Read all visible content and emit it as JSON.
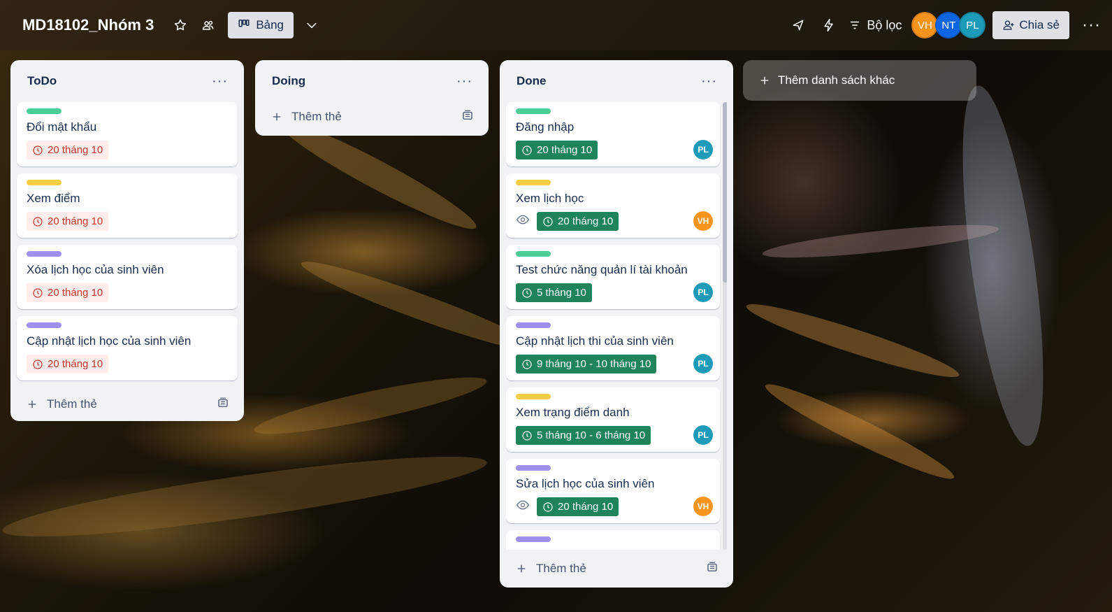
{
  "header": {
    "board_title": "MD18102_Nhóm 3",
    "view_label": "Bảng",
    "filter_label": "Bộ lọc",
    "share_label": "Chia sẻ",
    "members": [
      {
        "initials": "VH",
        "color": "#f7941d"
      },
      {
        "initials": "NT",
        "color": "#0c66e4"
      },
      {
        "initials": "PL",
        "color": "#1d9bb8"
      }
    ]
  },
  "colors": {
    "label_green": "#4bce97",
    "label_yellow": "#f5cd47",
    "label_purple": "#9f8fef",
    "due_red": "#c9372c",
    "done_green": "#1f845a"
  },
  "lists": {
    "todo": {
      "title": "ToDo",
      "add_card_label": "Thêm thẻ",
      "cards": [
        {
          "title": "Đổi mật khẩu",
          "label_color": "green",
          "date": "20 tháng 10"
        },
        {
          "title": "Xem điểm",
          "label_color": "yellow",
          "date": "20 tháng 10"
        },
        {
          "title": "Xóa lịch học của sinh viên",
          "label_color": "purple",
          "date": "20 tháng 10"
        },
        {
          "title": "Cập nhật lịch học của sinh viên",
          "label_color": "purple",
          "date": "20 tháng 10"
        }
      ]
    },
    "doing": {
      "title": "Doing",
      "add_card_label": "Thêm thẻ"
    },
    "done": {
      "title": "Done",
      "add_card_label": "Thêm thẻ",
      "cards": [
        {
          "title": "Đăng nhập",
          "label_color": "green",
          "date": "20 tháng 10",
          "member": "PL",
          "watched": false
        },
        {
          "title": "Xem lịch học",
          "label_color": "yellow",
          "date": "20 tháng 10",
          "member": "VH",
          "watched": true
        },
        {
          "title": "Test chức năng quản lí tài khoản",
          "label_color": "green",
          "date": "5 tháng 10",
          "member": "PL",
          "watched": false
        },
        {
          "title": "Cập nhật lịch thi của sinh viên",
          "label_color": "purple",
          "date": "9 tháng 10 - 10 tháng 10",
          "member": "PL",
          "watched": false
        },
        {
          "title": "Xem trạng điểm danh",
          "label_color": "yellow",
          "date": "5 tháng 10 - 6 tháng 10",
          "member": "PL",
          "watched": false
        },
        {
          "title": "Sửa lịch học của sinh viên",
          "label_color": "purple",
          "date": "20 tháng 10",
          "member": "VH",
          "watched": true
        }
      ]
    }
  },
  "add_list_label": "Thêm danh sách khác"
}
